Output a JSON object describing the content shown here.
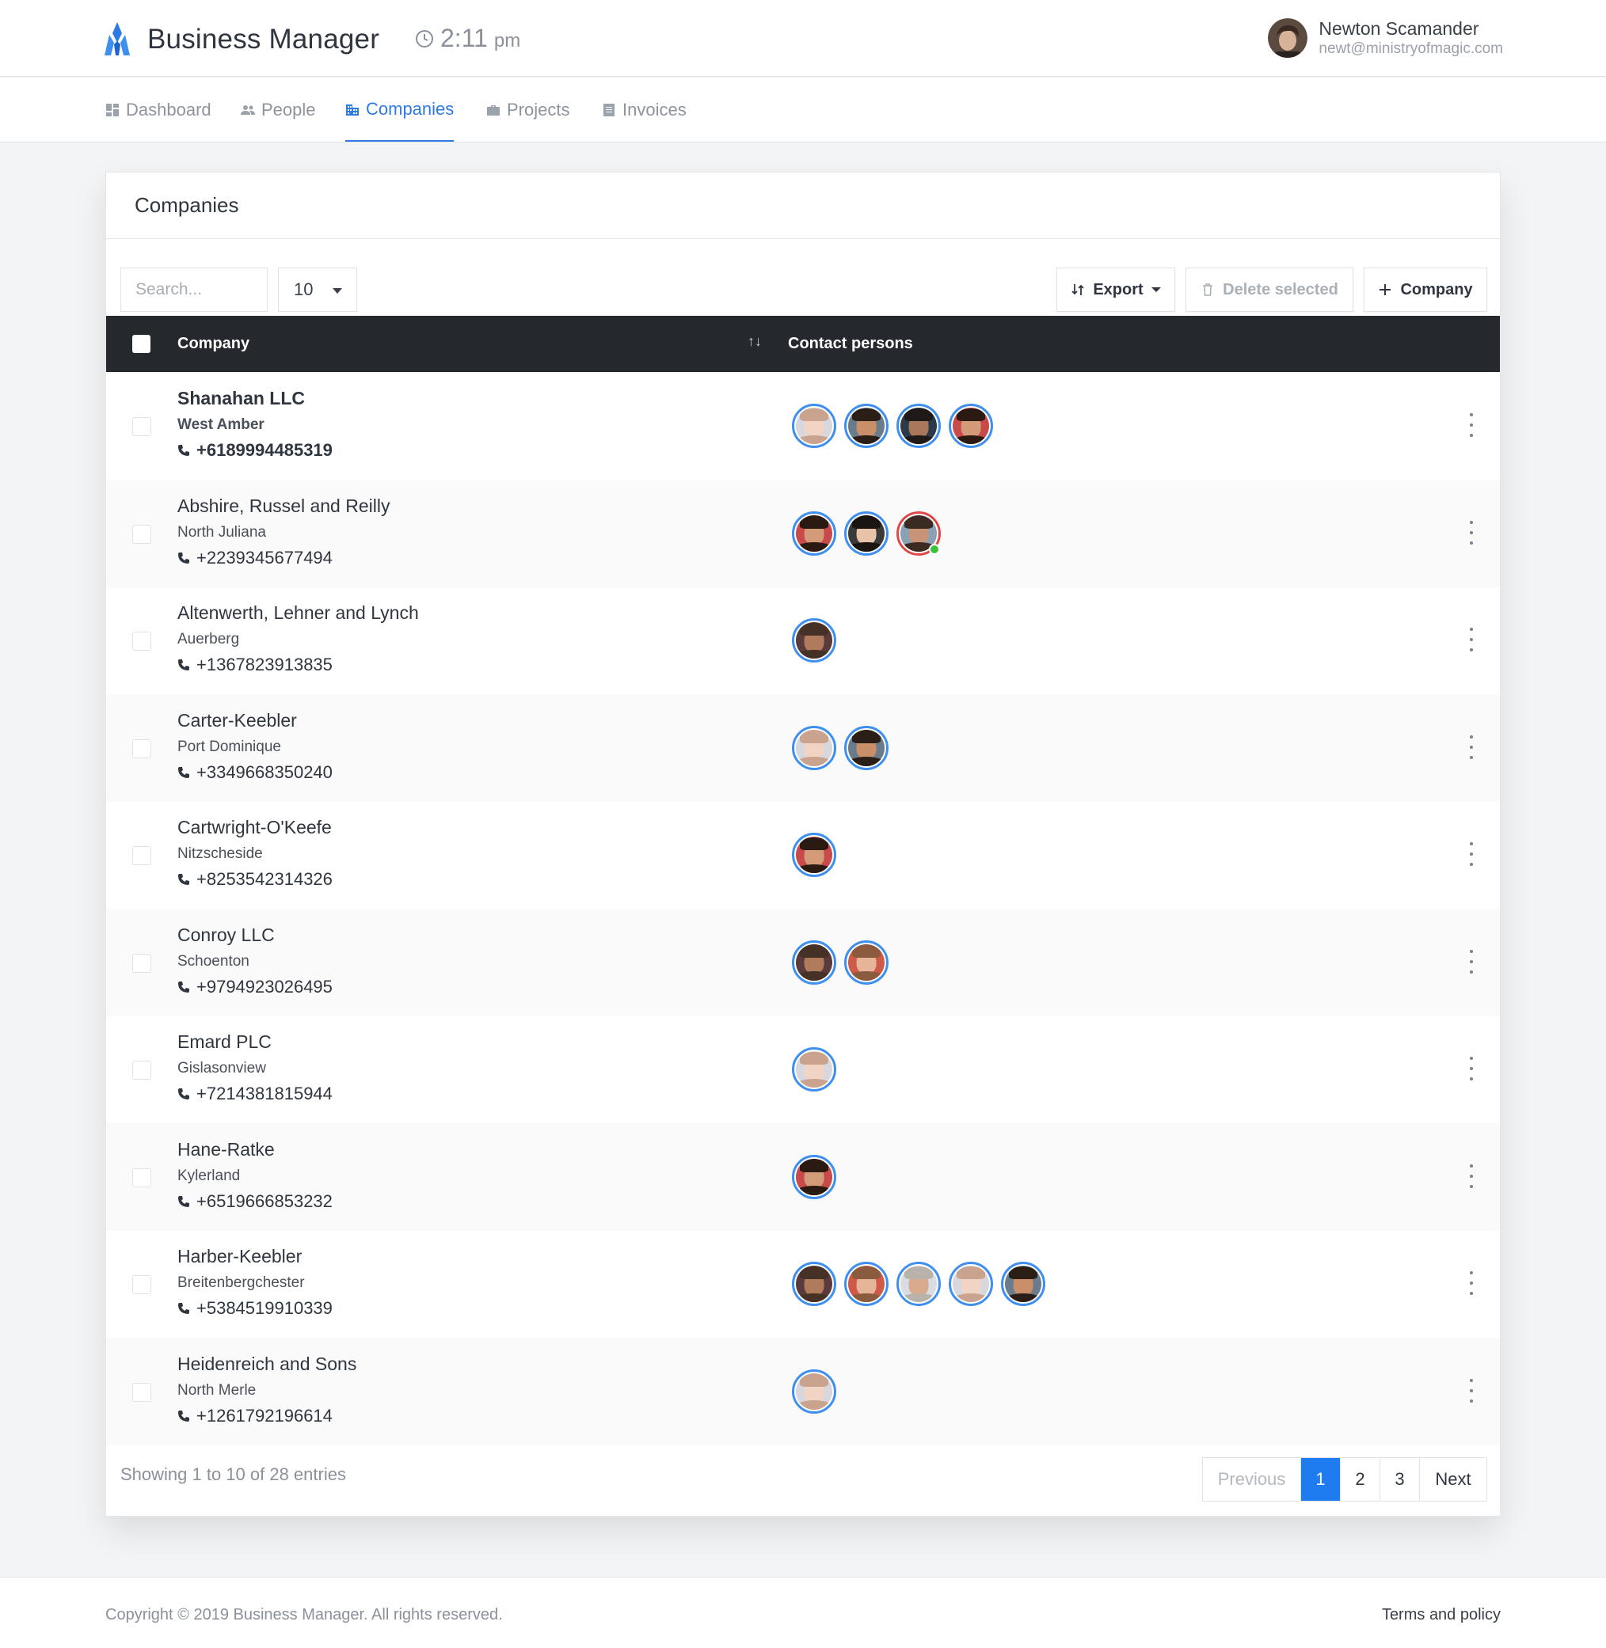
{
  "header": {
    "app_name": "Business Manager",
    "time": "2:11",
    "ampm": "pm",
    "user_name": "Newton Scamander",
    "user_email": "newt@ministryofmagic.com"
  },
  "nav": {
    "items": [
      {
        "label": "Dashboard",
        "icon": "dashboard-icon",
        "active": false
      },
      {
        "label": "People",
        "icon": "people-icon",
        "active": false
      },
      {
        "label": "Companies",
        "icon": "companies-icon",
        "active": true
      },
      {
        "label": "Projects",
        "icon": "briefcase-icon",
        "active": false
      },
      {
        "label": "Invoices",
        "icon": "invoice-icon",
        "active": false
      }
    ]
  },
  "card": {
    "title": "Companies",
    "search_placeholder": "Search...",
    "page_size": "10",
    "export_label": "Export",
    "delete_label": "Delete selected",
    "add_label": "Company"
  },
  "table": {
    "col_company": "Company",
    "col_contacts": "Contact persons",
    "rows": [
      {
        "name": "Shanahan LLC",
        "city": "West Amber",
        "phone": "+6189994485319",
        "contacts": 4,
        "bold": true
      },
      {
        "name": "Abshire, Russel and Reilly",
        "city": "North Juliana",
        "phone": "+2239345677494",
        "contacts": 3,
        "online_last": true
      },
      {
        "name": "Altenwerth, Lehner and Lynch",
        "city": "Auerberg",
        "phone": "+1367823913835",
        "contacts": 1
      },
      {
        "name": "Carter-Keebler",
        "city": "Port Dominique",
        "phone": "+3349668350240",
        "contacts": 2
      },
      {
        "name": "Cartwright-O'Keefe",
        "city": "Nitzscheside",
        "phone": "+8253542314326",
        "contacts": 1
      },
      {
        "name": "Conroy LLC",
        "city": "Schoenton",
        "phone": "+9794923026495",
        "contacts": 2
      },
      {
        "name": "Emard PLC",
        "city": "Gislasonview",
        "phone": "+7214381815944",
        "contacts": 1
      },
      {
        "name": "Hane-Ratke",
        "city": "Kylerland",
        "phone": "+6519666853232",
        "contacts": 1
      },
      {
        "name": "Harber-Keebler",
        "city": "Breitenbergchester",
        "phone": "+5384519910339",
        "contacts": 5
      },
      {
        "name": "Heidenreich and Sons",
        "city": "North Merle",
        "phone": "+1261792196614",
        "contacts": 1
      }
    ]
  },
  "pagination": {
    "summary": "Showing 1 to 10 of 28 entries",
    "prev": "Previous",
    "pages": [
      "1",
      "2",
      "3"
    ],
    "next": "Next"
  },
  "footer": {
    "copyright": "Copyright © 2019 Business Manager. All rights reserved.",
    "terms": "Terms and policy"
  },
  "colors": {
    "accent": "#2f7be5",
    "avatar_ring": "#3e8ff0",
    "table_header": "#25282d",
    "online": "#3cc13b"
  }
}
